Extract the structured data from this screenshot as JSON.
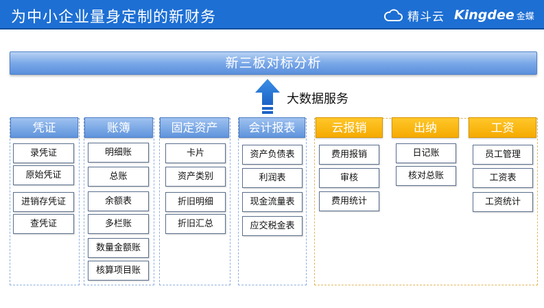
{
  "header": {
    "title": "为中小企业量身定制的新财务",
    "brand_cloud": "精斗云",
    "brand_kingdee": "Kingdee",
    "brand_kingdee_cn": "金蝶"
  },
  "banner": {
    "label": "新三板对标分析"
  },
  "big_data": {
    "label": "大数据服务"
  },
  "colors": {
    "header": "#1d6fd4",
    "blue_head": "#5f94dc",
    "gold_head": "#f5aa00"
  },
  "columns": [
    {
      "title": "凭证",
      "items": [
        "录凭证",
        "原始凭证",
        "进销存凭证",
        "查凭证"
      ]
    },
    {
      "title": "账簿",
      "items": [
        "明细账",
        "总账",
        "余额表",
        "多栏账",
        "数量金额账",
        "核算项目账"
      ]
    },
    {
      "title": "固定资产",
      "items": [
        "卡片",
        "资产类别",
        "折旧明细",
        "折旧汇总"
      ]
    },
    {
      "title": "会计报表",
      "items": [
        "资产负债表",
        "利润表",
        "现金流量表",
        "应交税金表"
      ]
    },
    {
      "title": "云报销",
      "items": [
        "费用报销",
        "审核",
        "费用统计"
      ]
    },
    {
      "title": "出纳",
      "items": [
        "日记账",
        "核对总账"
      ]
    },
    {
      "title": "工资",
      "items": [
        "员工管理",
        "工资表",
        "工资统计"
      ]
    }
  ]
}
